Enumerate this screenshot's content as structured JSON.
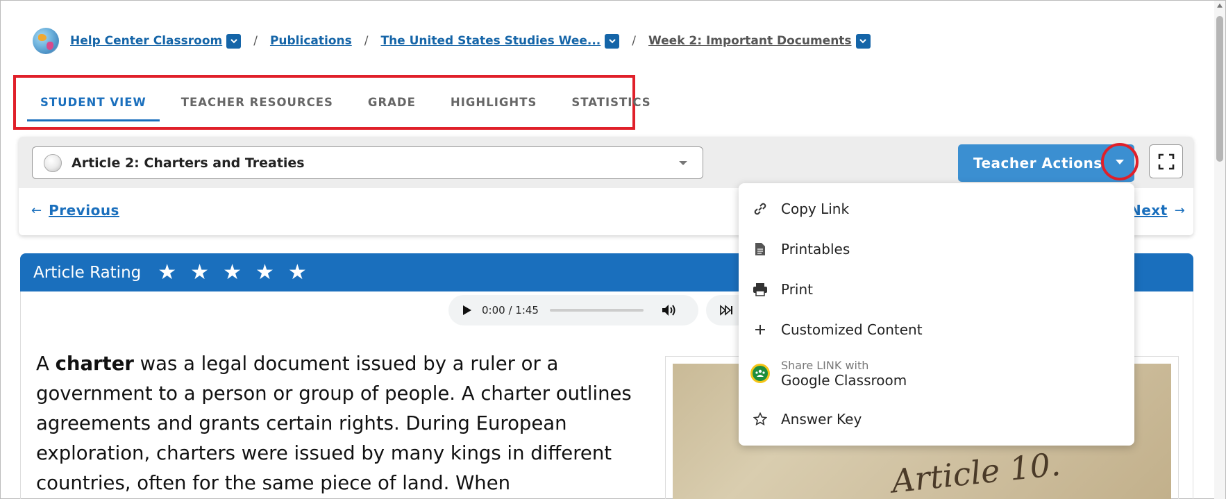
{
  "breadcrumb": {
    "items": [
      {
        "label": "Help Center Classroom",
        "has_dropdown": true
      },
      {
        "label": "Publications",
        "has_dropdown": false
      },
      {
        "label": "The United States Studies Wee...",
        "has_dropdown": true
      },
      {
        "label": "Week 2: Important Documents",
        "has_dropdown": true
      }
    ],
    "separator": "/"
  },
  "tabs": [
    {
      "label": "STUDENT VIEW",
      "active": true
    },
    {
      "label": "TEACHER RESOURCES",
      "active": false
    },
    {
      "label": "GRADE",
      "active": false
    },
    {
      "label": "HIGHLIGHTS",
      "active": false
    },
    {
      "label": "STATISTICS",
      "active": false
    }
  ],
  "toolbar": {
    "article_select": "Article 2: Charters and Treaties",
    "teacher_actions_label": "Teacher Actions",
    "previous_label": "Previous",
    "next_label": "Next"
  },
  "menu": {
    "items": [
      {
        "label": "Copy Link",
        "icon": "link-icon"
      },
      {
        "label": "Printables",
        "icon": "document-icon"
      },
      {
        "label": "Print",
        "icon": "printer-icon"
      },
      {
        "label": "Customized Content",
        "icon": "plus-icon"
      },
      {
        "label_sub": "Share LINK with",
        "label": "Google Classroom",
        "icon": "google-classroom-icon"
      },
      {
        "label": "Answer Key",
        "icon": "star-outline-icon"
      }
    ]
  },
  "rating": {
    "label": "Article Rating",
    "stars": 5
  },
  "audio": {
    "time": "0:00 / 1:45"
  },
  "article": {
    "lead": "A ",
    "bold_term": "charter",
    "text": " was a legal document issued by a ruler or a government to a person or group of people. A charter outlines agreements and grants certain rights. During European exploration, charters were issued by many kings in different countries, often for the same piece of land. When"
  },
  "image": {
    "caption_script": "Article 10."
  },
  "colors": {
    "primary": "#1a6fbd",
    "teacher_actions": "#3b8fd1",
    "highlight_red": "#e0202a"
  }
}
